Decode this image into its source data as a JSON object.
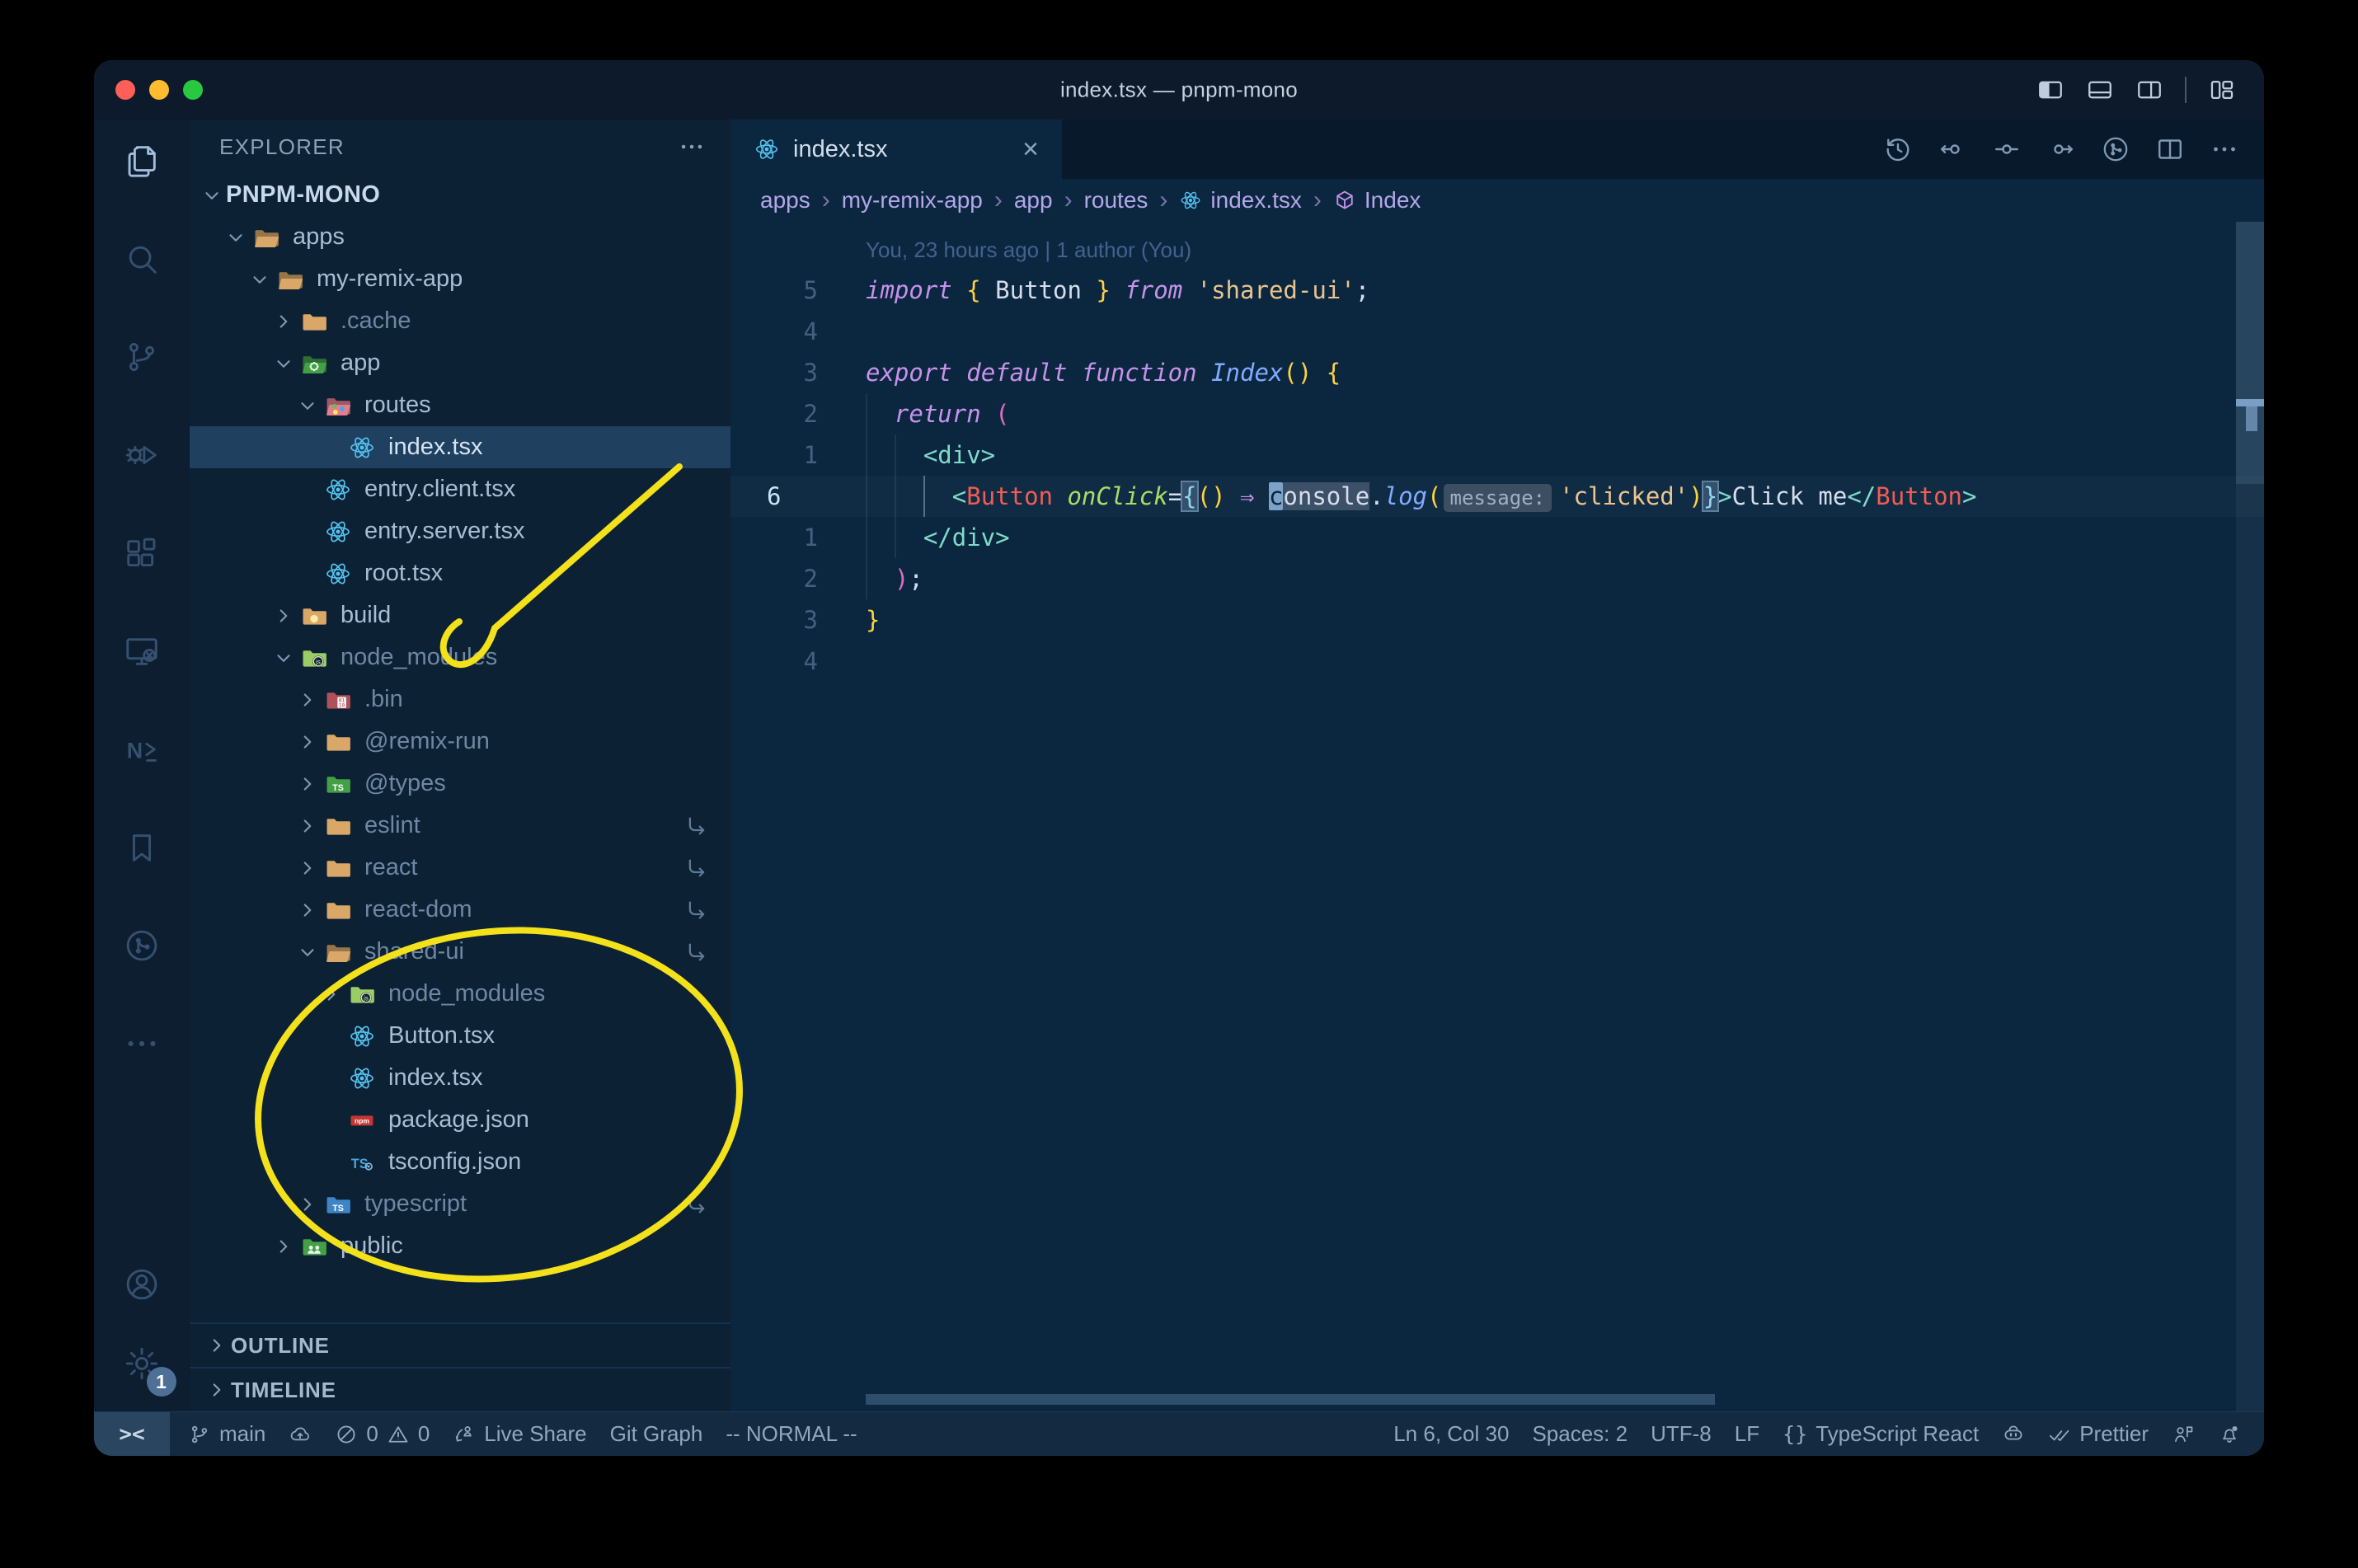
{
  "window": {
    "title": "index.tsx — pnpm-mono"
  },
  "titlebar": {
    "traffic_lights": [
      "close",
      "minimize",
      "zoom"
    ],
    "layout_icons": [
      "toggle-primary-sidebar",
      "toggle-panel",
      "toggle-secondary-sidebar",
      "customize-layout"
    ]
  },
  "activity_bar": {
    "items": [
      {
        "name": "explorer",
        "active": true
      },
      {
        "name": "search"
      },
      {
        "name": "source-control"
      },
      {
        "name": "run-debug"
      },
      {
        "name": "extensions"
      },
      {
        "name": "remote-explorer"
      },
      {
        "name": "nx-console"
      },
      {
        "name": "bookmarks"
      },
      {
        "name": "git-graph"
      },
      {
        "name": "more-views"
      }
    ],
    "bottom": [
      {
        "name": "accounts"
      },
      {
        "name": "settings",
        "badge": "1"
      }
    ]
  },
  "explorer": {
    "header": "EXPLORER",
    "tree": [
      {
        "label": "PNPM-MONO",
        "level": 0,
        "chevron": "down",
        "root": true
      },
      {
        "label": "apps",
        "level": 1,
        "chevron": "down",
        "icon": "folder-open"
      },
      {
        "label": "my-remix-app",
        "level": 2,
        "chevron": "down",
        "icon": "folder-open"
      },
      {
        "label": ".cache",
        "level": 3,
        "chevron": "right",
        "icon": "folder",
        "dim": true
      },
      {
        "label": "app",
        "level": 3,
        "chevron": "down",
        "icon": "folder-app"
      },
      {
        "label": "routes",
        "level": 4,
        "chevron": "down",
        "icon": "folder-routes"
      },
      {
        "label": "index.tsx",
        "level": 5,
        "icon": "react",
        "selected": true
      },
      {
        "label": "entry.client.tsx",
        "level": 4,
        "icon": "react"
      },
      {
        "label": "entry.server.tsx",
        "level": 4,
        "icon": "react"
      },
      {
        "label": "root.tsx",
        "level": 4,
        "icon": "react"
      },
      {
        "label": "build",
        "level": 3,
        "chevron": "right",
        "icon": "folder-build"
      },
      {
        "label": "node_modules",
        "level": 3,
        "chevron": "down",
        "icon": "folder-node",
        "dim": true
      },
      {
        "label": ".bin",
        "level": 4,
        "chevron": "right",
        "icon": "folder-bin",
        "dim": true
      },
      {
        "label": "@remix-run",
        "level": 4,
        "chevron": "right",
        "icon": "folder",
        "dim": true
      },
      {
        "label": "@types",
        "level": 4,
        "chevron": "right",
        "icon": "folder-types",
        "dim": true
      },
      {
        "label": "eslint",
        "level": 4,
        "chevron": "right",
        "icon": "folder",
        "dim": true,
        "symlink": true
      },
      {
        "label": "react",
        "level": 4,
        "chevron": "right",
        "icon": "folder",
        "dim": true,
        "symlink": true
      },
      {
        "label": "react-dom",
        "level": 4,
        "chevron": "right",
        "icon": "folder",
        "dim": true,
        "symlink": true
      },
      {
        "label": "shared-ui",
        "level": 4,
        "chevron": "down",
        "icon": "folder-open",
        "dim": true,
        "symlink": true
      },
      {
        "label": "node_modules",
        "level": 5,
        "chevron": "right",
        "icon": "folder-node",
        "dim": true
      },
      {
        "label": "Button.tsx",
        "level": 5,
        "icon": "react"
      },
      {
        "label": "index.tsx",
        "level": 5,
        "icon": "react"
      },
      {
        "label": "package.json",
        "level": 5,
        "icon": "npm"
      },
      {
        "label": "tsconfig.json",
        "level": 5,
        "icon": "tsconfig"
      },
      {
        "label": "typescript",
        "level": 4,
        "chevron": "right",
        "icon": "folder-ts",
        "dim": true,
        "symlink": true
      },
      {
        "label": "public",
        "level": 3,
        "chevron": "right",
        "icon": "folder-public"
      }
    ],
    "bottom_sections": [
      "OUTLINE",
      "TIMELINE"
    ]
  },
  "tabs": [
    {
      "label": "index.tsx",
      "icon": "react",
      "close": "×",
      "active": true
    }
  ],
  "editor_toolbar": [
    "history",
    "gitlens-left",
    "gitlens-center",
    "gitlens-right",
    "git-graph",
    "split-editor",
    "more"
  ],
  "breadcrumbs": [
    {
      "label": "apps"
    },
    {
      "label": "my-remix-app"
    },
    {
      "label": "app"
    },
    {
      "label": "routes"
    },
    {
      "label": "index.tsx",
      "icon": "react"
    },
    {
      "label": "Index",
      "icon": "symbol-cube"
    }
  ],
  "editor": {
    "blame": "You, 23 hours ago | 1 author (You)",
    "cursor": "Ln 6, Col 30",
    "lines": [
      {
        "blame": true,
        "tokens": [
          {
            "t": "You, 23 hours ago | 1 author (You)",
            "c": "blame"
          }
        ]
      },
      {
        "gutter": "5",
        "tokens": [
          {
            "t": "import",
            "c": "kw"
          },
          {
            "t": " ",
            "c": "fg"
          },
          {
            "t": "{",
            "c": "b1"
          },
          {
            "t": " Button ",
            "c": "fg"
          },
          {
            "t": "}",
            "c": "b1"
          },
          {
            "t": " ",
            "c": "fg"
          },
          {
            "t": "from",
            "c": "kw"
          },
          {
            "t": " ",
            "c": "fg"
          },
          {
            "t": "'shared-ui'",
            "c": "str"
          },
          {
            "t": ";",
            "c": "fg"
          }
        ]
      },
      {
        "gutter": "4",
        "tokens": []
      },
      {
        "gutter": "3",
        "tokens": [
          {
            "t": "export",
            "c": "kw"
          },
          {
            "t": " ",
            "c": "fg"
          },
          {
            "t": "default",
            "c": "kw"
          },
          {
            "t": " ",
            "c": "fg"
          },
          {
            "t": "function",
            "c": "kw"
          },
          {
            "t": " ",
            "c": "fg"
          },
          {
            "t": "Index",
            "c": "fn"
          },
          {
            "t": "()",
            "c": "b1"
          },
          {
            "t": " ",
            "c": "fg"
          },
          {
            "t": "{",
            "c": "b1"
          }
        ]
      },
      {
        "gutter": "2",
        "guides": [
          {
            "ch": 0
          }
        ],
        "tokens": [
          {
            "t": "  ",
            "c": "fg"
          },
          {
            "t": "return",
            "c": "kw"
          },
          {
            "t": " ",
            "c": "fg"
          },
          {
            "t": "(",
            "c": "b2"
          }
        ]
      },
      {
        "gutter": "1",
        "guides": [
          {
            "ch": 0
          },
          {
            "ch": 2
          }
        ],
        "tokens": [
          {
            "t": "    ",
            "c": "fg"
          },
          {
            "t": "<div>",
            "c": "tag"
          }
        ]
      },
      {
        "gutter": "6",
        "current": true,
        "guides": [
          {
            "ch": 0
          },
          {
            "ch": 2
          },
          {
            "ch": 4,
            "active": true
          }
        ],
        "tokens": [
          {
            "t": "      ",
            "c": "fg"
          },
          {
            "t": "<",
            "c": "tag"
          },
          {
            "t": "Button",
            "c": "cmp"
          },
          {
            "t": " ",
            "c": "fg"
          },
          {
            "t": "onClick",
            "c": "attr"
          },
          {
            "t": "=",
            "c": "fg"
          },
          {
            "t": "{",
            "c": "bx"
          },
          {
            "t": "()",
            "c": "b1"
          },
          {
            "t": " ⇒ ",
            "c": "op"
          },
          {
            "t": "c",
            "c": "cur"
          },
          {
            "t": "onsole",
            "c": "sel"
          },
          {
            "t": ".",
            "c": "fg"
          },
          {
            "t": "log",
            "c": "fn"
          },
          {
            "t": "(",
            "c": "b1"
          },
          {
            "t": "message:",
            "c": "inlay"
          },
          {
            "t": "'clicked'",
            "c": "str"
          },
          {
            "t": ")",
            "c": "b1"
          },
          {
            "t": "}",
            "c": "bx"
          },
          {
            "t": ">",
            "c": "tag"
          },
          {
            "t": "Click me",
            "c": "fg"
          },
          {
            "t": "</",
            "c": "tag"
          },
          {
            "t": "Button",
            "c": "cmp"
          },
          {
            "t": ">",
            "c": "tag"
          }
        ]
      },
      {
        "gutter": "1",
        "guides": [
          {
            "ch": 0
          },
          {
            "ch": 2
          }
        ],
        "tokens": [
          {
            "t": "    ",
            "c": "fg"
          },
          {
            "t": "</div>",
            "c": "tag"
          }
        ]
      },
      {
        "gutter": "2",
        "guides": [
          {
            "ch": 0
          }
        ],
        "tokens": [
          {
            "t": "  ",
            "c": "fg"
          },
          {
            "t": ")",
            "c": "b2"
          },
          {
            "t": ";",
            "c": "fg"
          }
        ]
      },
      {
        "gutter": "3",
        "tokens": [
          {
            "t": "}",
            "c": "b1"
          }
        ]
      },
      {
        "gutter": "4",
        "tokens": []
      }
    ]
  },
  "status_bar": {
    "left": [
      {
        "name": "remote",
        "label": "><"
      },
      {
        "name": "branch",
        "label": "main",
        "icon": "branch"
      },
      {
        "name": "publish",
        "icon": "cloud-upload"
      },
      {
        "name": "problems",
        "errors": "0",
        "warnings": "0"
      },
      {
        "name": "live-share",
        "label": "Live Share",
        "icon": "live-share"
      },
      {
        "name": "git-graph",
        "label": "Git Graph"
      },
      {
        "name": "vim-mode",
        "label": "-- NORMAL --"
      }
    ],
    "right": [
      {
        "name": "cursor-position",
        "label": "Ln 6, Col 30"
      },
      {
        "name": "indentation",
        "label": "Spaces: 2"
      },
      {
        "name": "encoding",
        "label": "UTF-8"
      },
      {
        "name": "eol",
        "label": "LF"
      },
      {
        "name": "language",
        "label": "TypeScript React",
        "icon": "braces"
      },
      {
        "name": "copilot",
        "icon": "copilot"
      },
      {
        "name": "formatter",
        "label": "Prettier",
        "icon": "double-check"
      },
      {
        "name": "feedback",
        "icon": "person-flag"
      },
      {
        "name": "notifications",
        "icon": "bell",
        "badge": true
      }
    ]
  },
  "annotations": {
    "arrow": {
      "color": "#f3e11c",
      "points_to": "node_modules folder in explorer"
    },
    "ellipse": {
      "color": "#f3e11c",
      "encircles": "shared-ui package contents"
    }
  },
  "colors": {
    "keyword": "#c792ea",
    "string": "#ecc48d",
    "tag": "#7fdbca",
    "component": "#f25c54",
    "attribute": "#addb67",
    "function_name": "#82aaff",
    "bracket_gold": "#ffd23f",
    "bracket_pink": "#de6bc0",
    "foreground": "#d6deeb",
    "react_blue": "#53c1f0",
    "editor_bg": "#0b2740",
    "sidebar_bg": "#0d2134",
    "titlebar_bg": "#0c1a2c",
    "statusbar_bg": "#142a40",
    "annotation_yellow": "#f3e11c",
    "folder_tan": "#d9a868",
    "folder_green": "#43a047",
    "folder_node_green": "#9ccc65",
    "folder_pink": "#e57e8c",
    "folder_maroon": "#b05058",
    "folder_blue": "#3d85c6",
    "npm_red": "#c53635",
    "ts_blue": "#4aa3e0",
    "traffic_red": "#ff5f57",
    "traffic_yellow": "#febc2e",
    "traffic_green": "#28c840"
  }
}
